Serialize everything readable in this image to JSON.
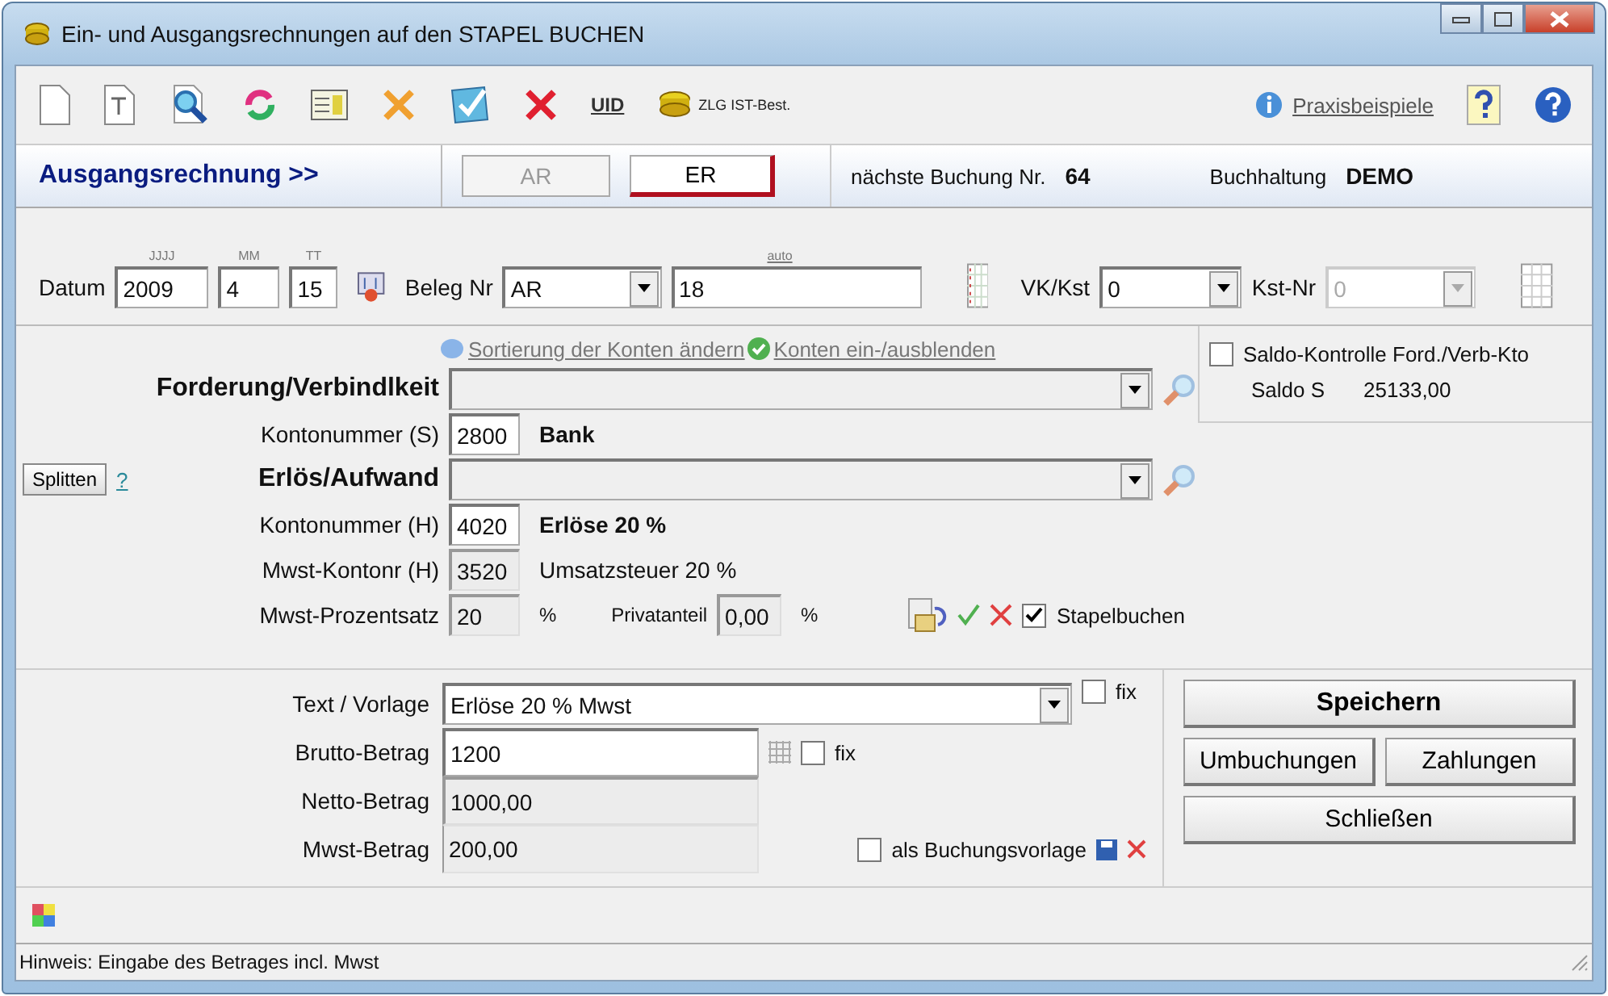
{
  "window": {
    "title": "Ein- und Ausgangsrechnungen auf den STAPEL BUCHEN"
  },
  "toolbar": {
    "uid_label": "UID",
    "zlg_label": "ZLG IST-Best.",
    "help_link": "Praxisbeispiele"
  },
  "header": {
    "title": "Ausgangsrechnung >>",
    "tabs": [
      {
        "label": "AR",
        "selected": false
      },
      {
        "label": "ER",
        "selected": true
      }
    ],
    "next_label": "nächste Buchung Nr.",
    "next_value": "64",
    "company_label": "Buchhaltung",
    "company_value": "DEMO"
  },
  "date_row": {
    "label": "Datum",
    "year": {
      "hint": "JJJJ",
      "value": "2009"
    },
    "month": {
      "hint": "MM",
      "value": "4"
    },
    "day": {
      "hint": "TT",
      "value": "15"
    },
    "beleg_label": "Beleg Nr",
    "beleg_prefix": "AR",
    "auto_hint": "auto",
    "beleg_number": "18",
    "vk_label": "VK/Kst",
    "vk_value": "0",
    "kst_label": "Kst-Nr",
    "kst_value": "0",
    "kst_disabled": true
  },
  "accounts": {
    "links": [
      "Sortierung der Konten ändern",
      "Konten ein-/ausblenden"
    ],
    "split_button": "Splitten",
    "split_help": "?",
    "rows": [
      {
        "kind": "combo",
        "label": "Forderung/Verbindlkeit"
      },
      {
        "kind": "account",
        "label": "Kontonummer (S)",
        "value": "2800",
        "readonly": false,
        "description": "Bank",
        "desc_bold": true
      },
      {
        "kind": "combo",
        "label": "Erlös/Aufwand"
      },
      {
        "kind": "account",
        "label": "Kontonummer (H)",
        "value": "4020",
        "readonly": false,
        "description": "Erlöse 20 %",
        "desc_bold": true
      },
      {
        "kind": "account",
        "label": "Mwst-Kontonr (H)",
        "value": "3520",
        "readonly": true,
        "description": "Umsatzsteuer 20 %",
        "desc_bold": false
      },
      {
        "kind": "percent",
        "label": "Mwst-Prozentsatz",
        "value": "20",
        "readonly": true,
        "unit": "%",
        "private_label": "Privatanteil",
        "private_value": "0,00",
        "private_unit": "%"
      }
    ]
  },
  "saldo": {
    "checked": false,
    "label": "Saldo-Kontrolle Ford./Verb-Kto",
    "saldo_label": "Saldo S",
    "saldo_value": "25133,00"
  },
  "stapel": {
    "checked": true,
    "label": "Stapelbuchen"
  },
  "amounts": {
    "text_label": "Text / Vorlage",
    "text_value": "Erlöse 20 % Mwst",
    "text_fix": {
      "checked": false,
      "label": "fix"
    },
    "brutto_label": "Brutto-Betrag",
    "brutto_value": "1200",
    "brutto_fix": {
      "checked": false,
      "label": "fix"
    },
    "netto_label": "Netto-Betrag",
    "netto_value": "1000,00",
    "mwst_label": "Mwst-Betrag",
    "mwst_value": "200,00",
    "template": {
      "checked": false,
      "label": "als Buchungsvorlage"
    }
  },
  "buttons": {
    "save": "Speichern",
    "rebook": "Umbuchungen",
    "payments": "Zahlungen",
    "close": "Schließen"
  },
  "status_bar": "Hinweis: Eingabe des Betrages incl. Mwst"
}
